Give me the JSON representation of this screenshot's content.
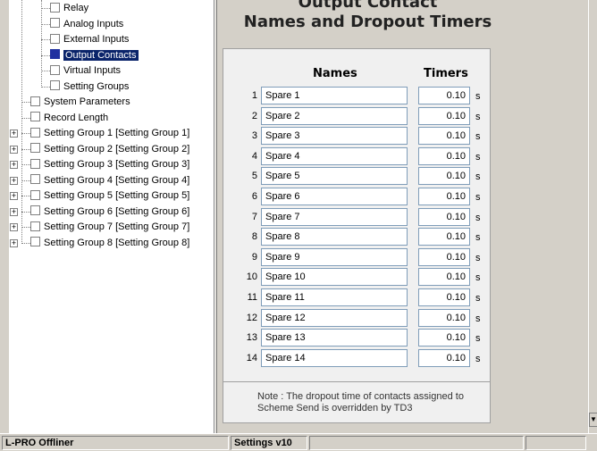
{
  "tree": {
    "items": [
      {
        "label": "Relay",
        "selected": false,
        "expandable": false
      },
      {
        "label": "Analog Inputs",
        "selected": false,
        "expandable": false
      },
      {
        "label": "External Inputs",
        "selected": false,
        "expandable": false
      },
      {
        "label": "Output Contacts",
        "selected": true,
        "expandable": false
      },
      {
        "label": "Virtual Inputs",
        "selected": false,
        "expandable": false
      },
      {
        "label": "Setting Groups",
        "selected": false,
        "expandable": false
      },
      {
        "label": "System Parameters",
        "selected": false,
        "expandable": false
      },
      {
        "label": "Record Length",
        "selected": false,
        "expandable": false
      },
      {
        "label": "Setting Group 1 [Setting Group 1]",
        "selected": false,
        "expandable": true
      },
      {
        "label": "Setting Group 2 [Setting Group 2]",
        "selected": false,
        "expandable": true
      },
      {
        "label": "Setting Group 3 [Setting Group 3]",
        "selected": false,
        "expandable": true
      },
      {
        "label": "Setting Group 4 [Setting Group 4]",
        "selected": false,
        "expandable": true
      },
      {
        "label": "Setting Group 5 [Setting Group 5]",
        "selected": false,
        "expandable": true
      },
      {
        "label": "Setting Group 6 [Setting Group 6]",
        "selected": false,
        "expandable": true
      },
      {
        "label": "Setting Group 7 [Setting Group 7]",
        "selected": false,
        "expandable": true
      },
      {
        "label": "Setting Group 8 [Setting Group 8]",
        "selected": false,
        "expandable": true
      }
    ]
  },
  "main": {
    "title_line1": "Output Contact",
    "title_line2": "Names and Dropout Timers",
    "col_names": "Names",
    "col_timers": "Timers",
    "unit": "s",
    "rows": [
      {
        "num": "1",
        "name": "Spare 1",
        "timer": "0.10"
      },
      {
        "num": "2",
        "name": "Spare 2",
        "timer": "0.10"
      },
      {
        "num": "3",
        "name": "Spare 3",
        "timer": "0.10"
      },
      {
        "num": "4",
        "name": "Spare 4",
        "timer": "0.10"
      },
      {
        "num": "5",
        "name": "Spare 5",
        "timer": "0.10"
      },
      {
        "num": "6",
        "name": "Spare 6",
        "timer": "0.10"
      },
      {
        "num": "7",
        "name": "Spare 7",
        "timer": "0.10"
      },
      {
        "num": "8",
        "name": "Spare 8",
        "timer": "0.10"
      },
      {
        "num": "9",
        "name": "Spare 9",
        "timer": "0.10"
      },
      {
        "num": "10",
        "name": "Spare 10",
        "timer": "0.10"
      },
      {
        "num": "11",
        "name": "Spare 11",
        "timer": "0.10"
      },
      {
        "num": "12",
        "name": "Spare 12",
        "timer": "0.10"
      },
      {
        "num": "13",
        "name": "Spare 13",
        "timer": "0.10"
      },
      {
        "num": "14",
        "name": "Spare 14",
        "timer": "0.10"
      }
    ],
    "note": "Note : The dropout time of contacts assigned to Scheme Send is overridden by TD3"
  },
  "status": {
    "app": "L-PRO Offliner",
    "settings": "Settings v10"
  }
}
